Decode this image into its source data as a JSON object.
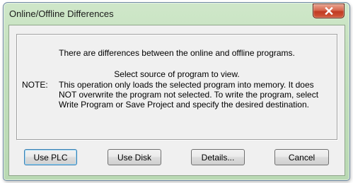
{
  "window": {
    "title": "Online/Offline Differences"
  },
  "message": {
    "line1": "There are differences between the online and offline programs.",
    "line2": "Select source of program to view.",
    "note_label": "NOTE:",
    "note_text": "This operation only loads the selected program into memory. It does NOT overwrite the program not selected. To write the program, select Write Program or Save Project and specify the desired destination."
  },
  "buttons": {
    "use_plc": "Use PLC",
    "use_disk": "Use Disk",
    "details": "Details...",
    "cancel": "Cancel"
  },
  "colors": {
    "title_bar": "#c3e0bd",
    "close_button": "#c13a22",
    "client_background": "#f0f0f0"
  },
  "icons": {
    "close": "close-icon"
  }
}
